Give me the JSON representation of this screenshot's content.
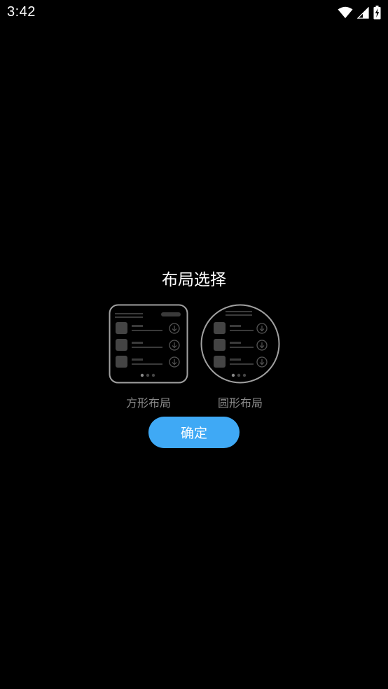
{
  "status_bar": {
    "time": "3:42",
    "icons": [
      "wifi-icon",
      "cell-signal-icon",
      "battery-charging-icon"
    ]
  },
  "dialog": {
    "title": "布局选择",
    "options": [
      {
        "label": "方形布局",
        "shape": "square"
      },
      {
        "label": "圆形布局",
        "shape": "round"
      }
    ],
    "confirm_label": "确定"
  },
  "colors": {
    "background": "#000000",
    "accent": "#3fa9f5",
    "label": "#8a8a8a",
    "preview_stroke": "#9a9a9a"
  }
}
